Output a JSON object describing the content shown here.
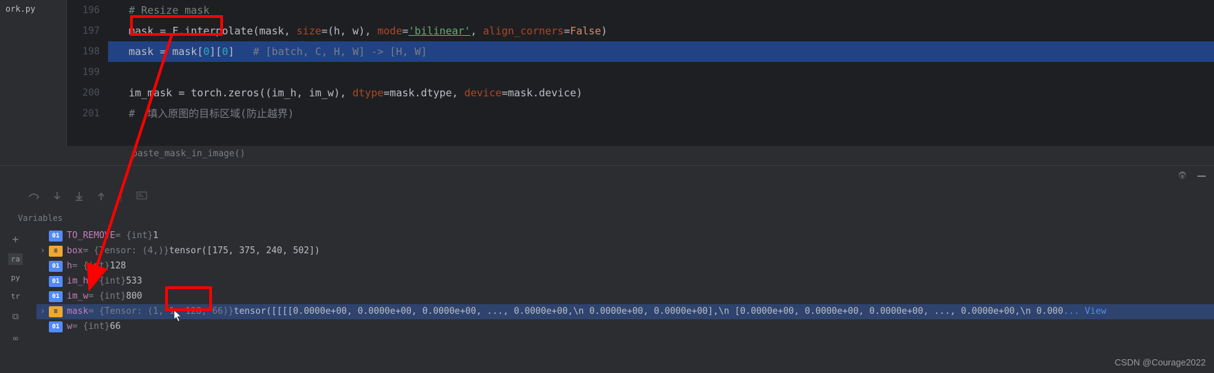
{
  "file_tab": "ork.py",
  "gutter": [
    "196",
    "197",
    "198",
    "199",
    "200",
    "201"
  ],
  "code": {
    "line196": "# Resize mask",
    "line197_var": "mask",
    "line197_eq": " = ",
    "line197_method": "F.interpolate",
    "line197_open": "(mask, ",
    "line197_p_size": "size",
    "line197_size_v": "=(h, w), ",
    "line197_p_mode": "mode",
    "line197_mode_eq": "=",
    "line197_mode_v": "'bilinear'",
    "line197_c": ", ",
    "line197_p_align": "align_corners",
    "line197_align_eq": "=",
    "line197_false": "False",
    "line197_close": ")",
    "line198_a": "mask = mask[",
    "line198_z1": "0",
    "line198_mid": "][",
    "line198_z2": "0",
    "line198_b": "]   ",
    "line198_comment": "# [batch, C, H, W] -> [H, W]",
    "line200_a": "im_mask = torch.zeros((im_h, im_w), ",
    "line200_p_dtype": "dtype",
    "line200_dtype_v": "=mask.dtype, ",
    "line200_p_device": "device",
    "line200_device_v": "=mask.device)",
    "line201_comment": "#  填入原图的目标区域(防止越界)"
  },
  "breadcrumb": "paste_mask_in_image()",
  "vars_label": "Variables",
  "vars": {
    "to_remove": {
      "name": "TO_REMOVE",
      "type": " = {int} ",
      "value": "1"
    },
    "box": {
      "name": "box",
      "type": " = {Tensor: (4,)} ",
      "value": "tensor([175, 375, 240, 502])"
    },
    "h": {
      "name": "h",
      "type": " = {int} ",
      "value": "128"
    },
    "im_h": {
      "name": "im_h",
      "type": " = {int} ",
      "value": "533"
    },
    "im_w": {
      "name": "im_w",
      "type": " = {int} ",
      "value": "800"
    },
    "mask": {
      "name": "mask",
      "type": " = {Tensor: (1, 1, 128, 66)} ",
      "value": "tensor([[[[0.0000e+00, 0.0000e+00, 0.0000e+00,  ..., 0.0000e+00,\\n          0.0000e+00, 0.0000e+00],\\n         [0.0000e+00, 0.0000e+00, 0.0000e+00,  ..., 0.0000e+00,\\n          0.000",
      "view": "... View"
    },
    "w": {
      "name": "w",
      "type": " = {int} ",
      "value": "66"
    }
  },
  "int_badge": "01",
  "tensor_badge": "≡",
  "watermark": "CSDN @Courage2022"
}
